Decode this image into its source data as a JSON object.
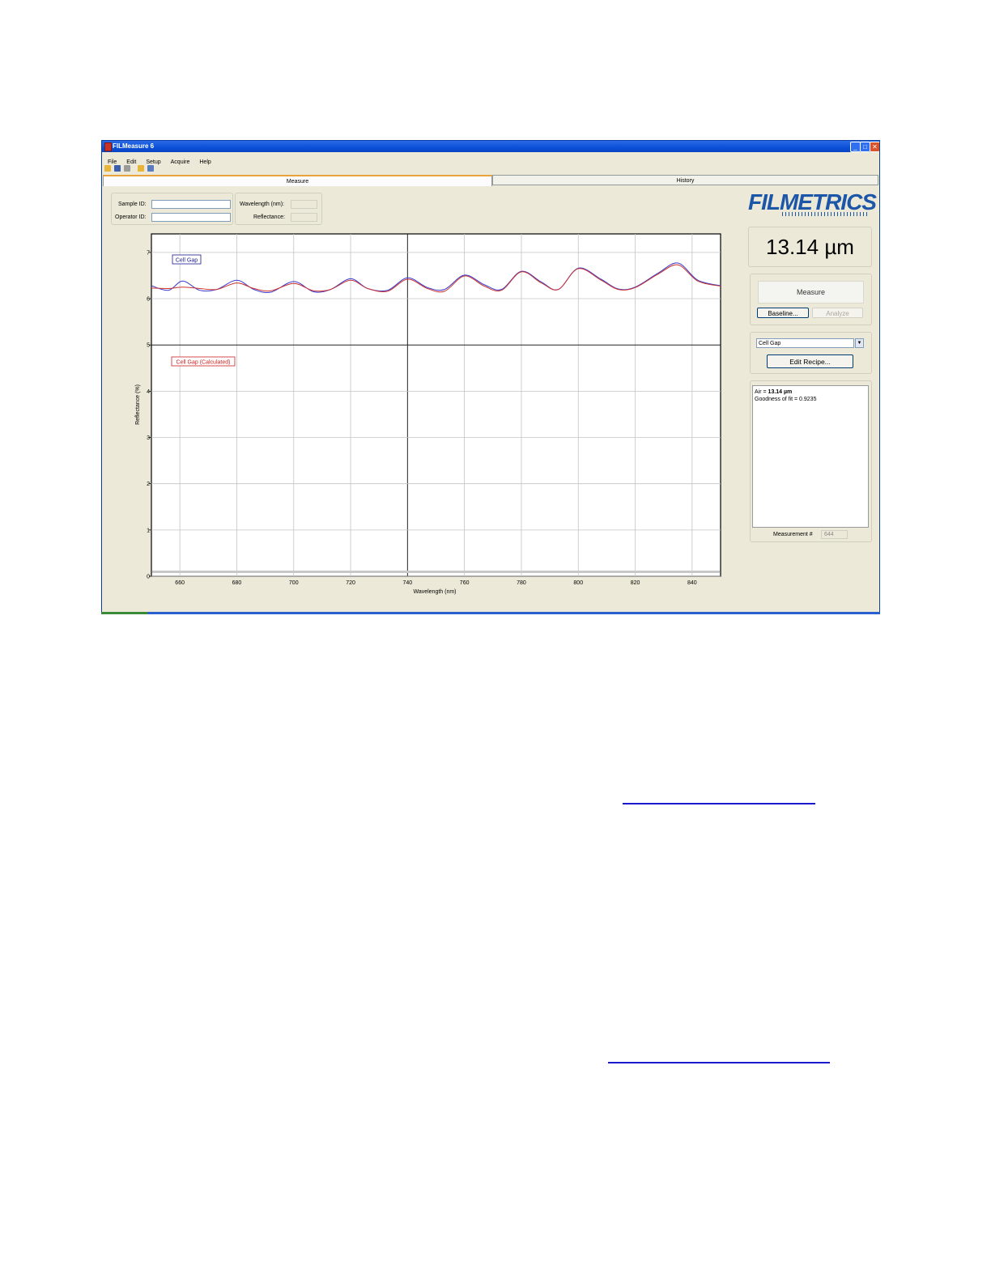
{
  "window": {
    "title": "FILMeasure 6",
    "minimize": "_",
    "maximize": "□",
    "close": "✕"
  },
  "menu": [
    "File",
    "Edit",
    "Setup",
    "Acquire",
    "Help"
  ],
  "toolbar_icons": [
    "open-folder-icon",
    "save-icon",
    "print-icon",
    "open-recipe-icon",
    "copy-icon"
  ],
  "tabs": {
    "measure": "Measure",
    "history": "History"
  },
  "sample_panel": {
    "sample_id_label": "Sample ID:",
    "operator_id_label": "Operator ID:",
    "sample_id_value": "",
    "operator_id_value": "",
    "wavelength_label": "Wavelength (nm):",
    "reflectance_label": "Reflectance:",
    "wavelength_value": "",
    "reflectance_value": ""
  },
  "logo": {
    "text": "FILMETRICS",
    "color": "#1b56a8"
  },
  "result": {
    "big_value": "13.14 µm"
  },
  "buttons": {
    "measure": "Measure",
    "baseline": "Baseline...",
    "analyze": "Analyze",
    "edit_recipe": "Edit Recipe..."
  },
  "recipe": {
    "selected": "Cell Gap",
    "arrow": "▼"
  },
  "results_text": {
    "line1_prefix": "Air = ",
    "line1_value": "13.14 µm",
    "line2": "Goodness of fit = 0.9235"
  },
  "measurement": {
    "label": "Measurement #",
    "value": "644"
  },
  "chart_data": {
    "type": "line",
    "xlabel": "Wavelength (nm)",
    "ylabel": "Reflectance (%)",
    "xlim": [
      650,
      850
    ],
    "ylim": [
      0,
      7.4
    ],
    "xticks": [
      660,
      680,
      700,
      720,
      740,
      760,
      780,
      800,
      820,
      840
    ],
    "yticks": [
      0,
      1,
      2,
      3,
      4,
      5,
      6,
      7
    ],
    "grid": true,
    "annotations": [
      {
        "text": "Cell Gap",
        "color": "#1a1a8c"
      },
      {
        "text": "Cell Gap (Calculated)",
        "color": "#cc2222"
      }
    ],
    "series": [
      {
        "name": "Cell Gap",
        "color": "#3a3acc",
        "x": [
          650,
          656,
          661,
          667,
          673,
          680,
          686,
          692,
          700,
          707,
          713,
          720,
          726,
          733,
          740,
          747,
          753,
          760,
          767,
          773,
          780,
          787,
          793,
          800,
          808,
          814,
          820,
          828,
          835,
          842,
          850
        ],
        "y": [
          6.28,
          6.18,
          6.38,
          6.18,
          6.2,
          6.4,
          6.2,
          6.14,
          6.37,
          6.15,
          6.2,
          6.43,
          6.22,
          6.18,
          6.45,
          6.24,
          6.2,
          6.51,
          6.3,
          6.2,
          6.59,
          6.36,
          6.2,
          6.66,
          6.42,
          6.21,
          6.25,
          6.55,
          6.77,
          6.4,
          6.28
        ]
      },
      {
        "name": "Cell Gap (Calculated)",
        "color": "#cc3333",
        "x": [
          650,
          656,
          661,
          667,
          673,
          680,
          686,
          692,
          700,
          707,
          713,
          720,
          726,
          733,
          740,
          747,
          753,
          760,
          767,
          773,
          780,
          787,
          793,
          800,
          808,
          814,
          820,
          828,
          835,
          842,
          850
        ],
        "y": [
          6.23,
          6.22,
          6.25,
          6.22,
          6.2,
          6.34,
          6.22,
          6.17,
          6.33,
          6.17,
          6.2,
          6.4,
          6.22,
          6.16,
          6.42,
          6.22,
          6.16,
          6.49,
          6.27,
          6.18,
          6.58,
          6.34,
          6.2,
          6.65,
          6.4,
          6.2,
          6.24,
          6.53,
          6.73,
          6.38,
          6.27
        ]
      }
    ]
  }
}
